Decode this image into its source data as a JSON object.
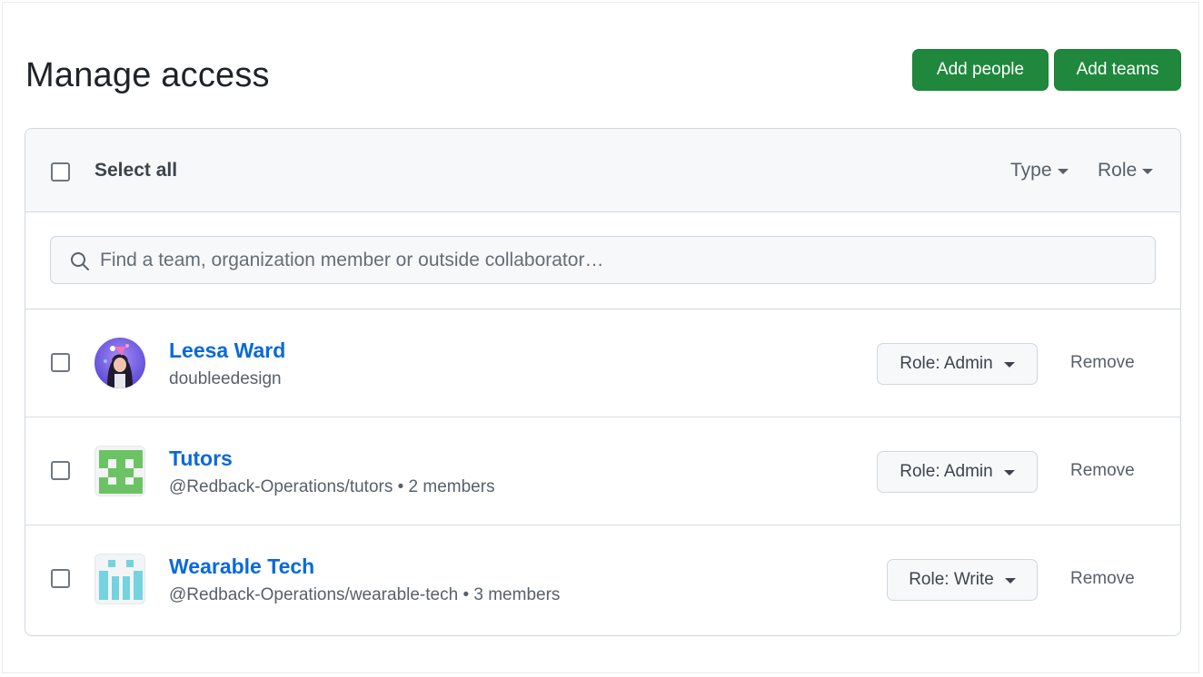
{
  "page": {
    "title": "Manage access",
    "add_people_label": "Add people",
    "add_teams_label": "Add teams"
  },
  "header": {
    "select_all_label": "Select all",
    "filters": [
      {
        "label": "Type",
        "icon": "caret-down-icon"
      },
      {
        "label": "Role",
        "icon": "caret-down-icon"
      }
    ]
  },
  "search": {
    "placeholder": "Find a team, organization member or outside collaborator…",
    "value": "",
    "icon": "search-icon"
  },
  "members": [
    {
      "name": "Leesa Ward",
      "subtitle": "doubleedesign",
      "role_label": "Role: Admin",
      "remove_label": "Remove",
      "avatar": "user-avatar"
    },
    {
      "name": "Tutors",
      "subtitle": "@Redback-Operations/tutors • 2 members",
      "role_label": "Role: Admin",
      "remove_label": "Remove",
      "avatar": "team-identicon",
      "avatar_color": "#6cc363"
    },
    {
      "name": "Wearable Tech",
      "subtitle": "@Redback-Operations/wearable-tech • 3 members",
      "role_label": "Role: Write",
      "remove_label": "Remove",
      "avatar": "team-identicon",
      "avatar_color": "#73d3df"
    }
  ],
  "colors": {
    "primary_button": "#1f883d",
    "link": "#0969da",
    "border": "#d0d7de",
    "header_bg": "#f6f8fa"
  }
}
